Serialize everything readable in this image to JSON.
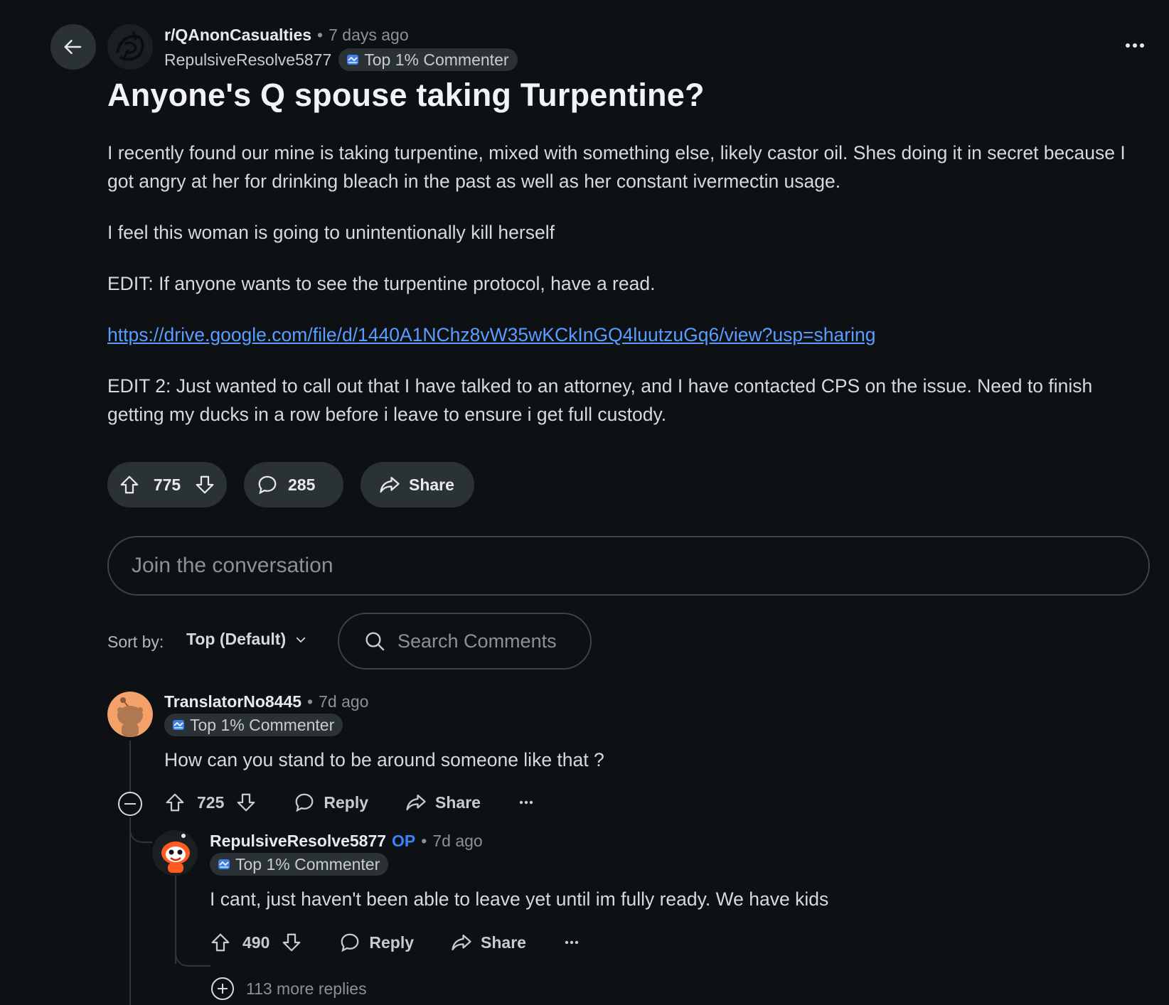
{
  "post": {
    "subreddit": "r/QAnonCasualties",
    "separator": "•",
    "time": "7 days ago",
    "author": "RepulsiveResolve5877",
    "author_badge": "Top 1% Commenter",
    "title": "Anyone's Q spouse taking Turpentine?",
    "body": [
      "I recently found our mine is taking turpentine, mixed with something else, likely castor oil. Shes doing it in secret because I got angry at her for drinking bleach in the past as well as her constant ivermectin usage.",
      "I feel this woman is going to unintentionally kill herself",
      "EDIT: If anyone wants to see the turpentine protocol, have a read.",
      "EDIT 2: Just wanted to call out that I have talked to an attorney, and I have contacted CPS on the issue. Need to finish getting my ducks in a row before i leave to ensure i get full custody."
    ],
    "link": "https://drive.google.com/file/d/1440A1NChz8vW35wKCkInGQ4luutzuGq6/view?usp=sharing",
    "votes": "775",
    "comments": "285",
    "share_label": "Share"
  },
  "composer": {
    "placeholder": "Join the conversation"
  },
  "sort": {
    "label": "Sort by:",
    "value": "Top (Default)"
  },
  "search": {
    "placeholder": "Search Comments"
  },
  "comments": [
    {
      "author": "TranslatorNo8445",
      "time": "7d ago",
      "badge": "Top 1% Commenter",
      "text": "How can you stand to be around someone like that ?",
      "votes": "725",
      "reply_label": "Reply",
      "share_label": "Share"
    },
    {
      "author": "RepulsiveResolve5877",
      "op": "OP",
      "time": "7d ago",
      "badge": "Top 1% Commenter",
      "text": "I cant, just haven't been able to leave yet until im fully ready. We have kids",
      "votes": "490",
      "reply_label": "Reply",
      "share_label": "Share"
    }
  ],
  "more_replies": "113 more replies",
  "colors": {
    "bg": "#0e1113",
    "pill": "#2a3236",
    "link": "#5a9cff",
    "op": "#3a82f7"
  }
}
